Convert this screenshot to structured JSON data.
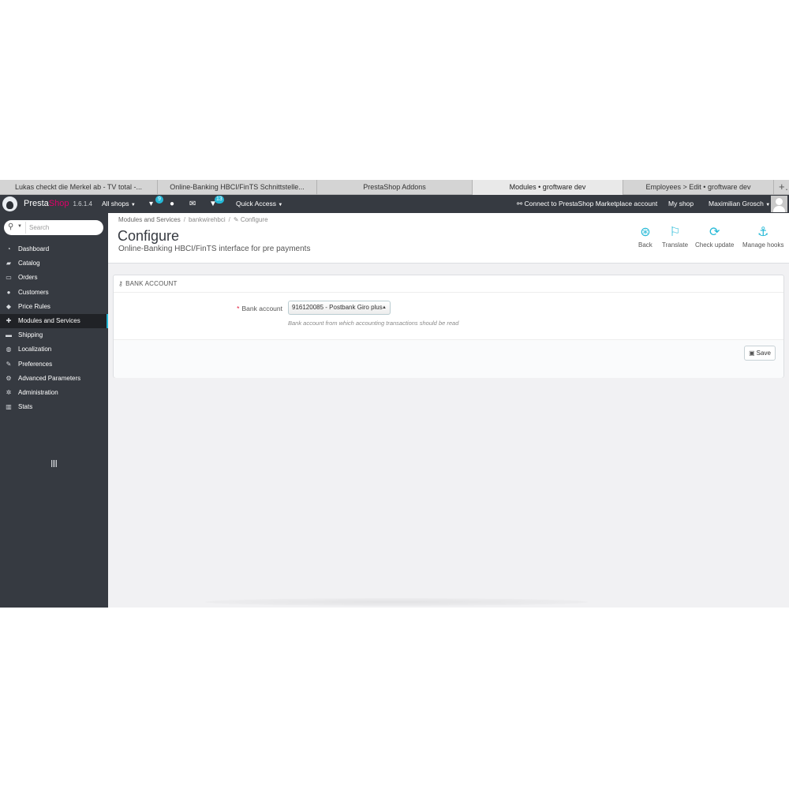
{
  "browser": {
    "tabs": [
      {
        "label": "Lukas checkt die Merkel ab - TV total -...",
        "active": false
      },
      {
        "label": "Online-Banking HBCI/FinTS Schnittstelle...",
        "active": false
      },
      {
        "label": "PrestaShop Addons",
        "active": false
      },
      {
        "label": "Modules • groftware dev",
        "active": true
      },
      {
        "label": "Employees > Edit • groftware dev",
        "active": false
      }
    ],
    "new_tab": "+"
  },
  "topnav": {
    "brand_a": "Presta",
    "brand_b": "Shop",
    "version": "1.6.1.4",
    "all_shops": "All shops",
    "cart_badge": "9",
    "notif_badge": "13",
    "quick_access": "Quick Access",
    "connect": "Connect to PrestaShop Marketplace account",
    "my_shop": "My shop",
    "user": "Maximilian Grosch"
  },
  "sidebar": {
    "search_placeholder": "Search",
    "items": [
      {
        "label": "Dashboard",
        "icon": "dashboard-icon",
        "glyph": "◔",
        "active": false
      },
      {
        "label": "Catalog",
        "icon": "book-icon",
        "glyph": "▰",
        "active": false
      },
      {
        "label": "Orders",
        "icon": "credit-card-icon",
        "glyph": "▭",
        "active": false
      },
      {
        "label": "Customers",
        "icon": "users-icon",
        "glyph": "●",
        "active": false
      },
      {
        "label": "Price Rules",
        "icon": "tags-icon",
        "glyph": "◆",
        "active": false
      },
      {
        "label": "Modules and Services",
        "icon": "puzzle-icon",
        "glyph": "✚",
        "active": true
      },
      {
        "label": "Shipping",
        "icon": "truck-icon",
        "glyph": "▬",
        "active": false
      },
      {
        "label": "Localization",
        "icon": "globe-icon",
        "glyph": "◍",
        "active": false
      },
      {
        "label": "Preferences",
        "icon": "wrench-icon",
        "glyph": "✎",
        "active": false
      },
      {
        "label": "Advanced Parameters",
        "icon": "cogs-icon",
        "glyph": "⚙",
        "active": false
      },
      {
        "label": "Administration",
        "icon": "cog-icon",
        "glyph": "✲",
        "active": false
      },
      {
        "label": "Stats",
        "icon": "bar-chart-icon",
        "glyph": "▥",
        "active": false
      }
    ]
  },
  "header": {
    "breadcrumb": [
      "Modules and Services",
      "bankwirehbci",
      "Configure"
    ],
    "title": "Configure",
    "subtitle": "Online-Banking HBCI/FinTS interface for pre payments",
    "toolbar": [
      {
        "label": "Back",
        "icon": "back-icon",
        "glyph": "⊛"
      },
      {
        "label": "Translate",
        "icon": "flag-icon",
        "glyph": "⚐"
      },
      {
        "label": "Check update",
        "icon": "refresh-icon",
        "glyph": "⟳"
      },
      {
        "label": "Manage hooks",
        "icon": "anchor-icon",
        "glyph": "⚓"
      }
    ]
  },
  "panel": {
    "heading": "BANK ACCOUNT",
    "bank_label": "Bank account",
    "bank_value": "916120085 - Postbank Giro plus",
    "help": "Bank account from which accounting transactions should be read",
    "save": "Save"
  },
  "colors": {
    "nav_bg": "#363a41",
    "accent": "#25b9d7",
    "brand_pink": "#df0067",
    "required": "#e31837"
  }
}
